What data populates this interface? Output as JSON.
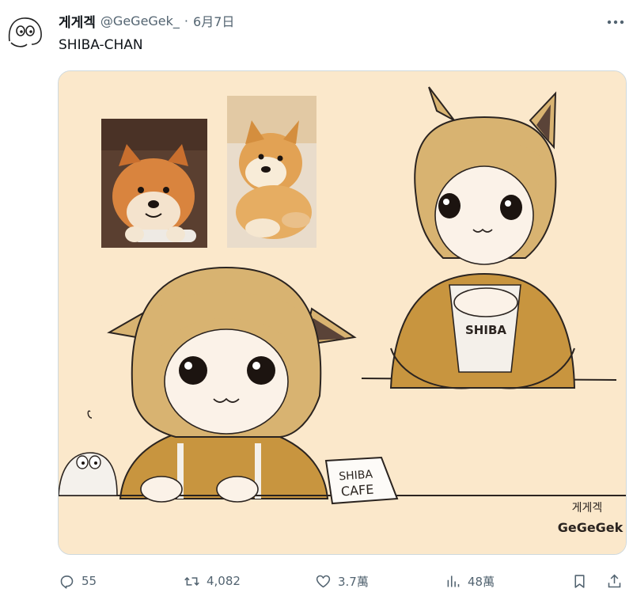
{
  "tweet": {
    "author": {
      "display_name": "게게겍",
      "handle": "@GeGeGek_",
      "separator": "·",
      "timestamp": "6月7日",
      "avatar_icon": "doodle-creature-avatar"
    },
    "text": "SHIBA-CHAN",
    "media": {
      "description_icon": "illustration-artwork",
      "name_card_line1": "SHIBA",
      "name_card_line2": "CAFE",
      "shirt_text": "SHIBA",
      "signature_line1": "게게겍",
      "signature_line2": "GeGeGek"
    },
    "actions": {
      "replies": "55",
      "retweets": "4,082",
      "likes": "3.7萬",
      "views": "48萬"
    }
  },
  "colors": {
    "text_primary": "#0f1419",
    "text_secondary": "#536471",
    "media_background": "#fbe8cb",
    "hair": "#d8b371",
    "shirt": "#c8953f"
  }
}
